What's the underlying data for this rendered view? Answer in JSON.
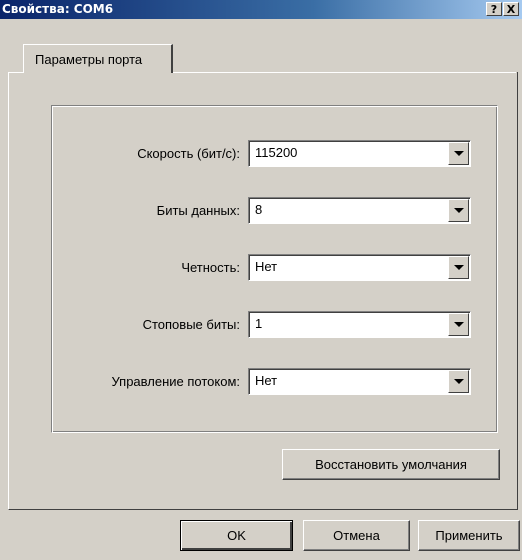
{
  "window": {
    "title": "Свойства: COM6",
    "help_label": "?",
    "close_label": "X"
  },
  "tabs": [
    {
      "label": "Параметры порта",
      "active": true
    }
  ],
  "settings": [
    {
      "label": "Скорость (бит/с):",
      "value": "115200"
    },
    {
      "label": "Биты данных:",
      "value": "8"
    },
    {
      "label": "Четность:",
      "value": "Нет"
    },
    {
      "label": "Стоповые биты:",
      "value": "1"
    },
    {
      "label": "Управление потоком:",
      "value": "Нет"
    }
  ],
  "restore_defaults_label": "Восстановить умолчания",
  "footer": {
    "ok_label": "OK",
    "cancel_label": "Отмена",
    "apply_label": "Применить"
  },
  "icons": {
    "dropdown": "chevron-down-icon"
  },
  "colors": {
    "title_bar": "#0a246a",
    "face": "#d4d0c8"
  }
}
